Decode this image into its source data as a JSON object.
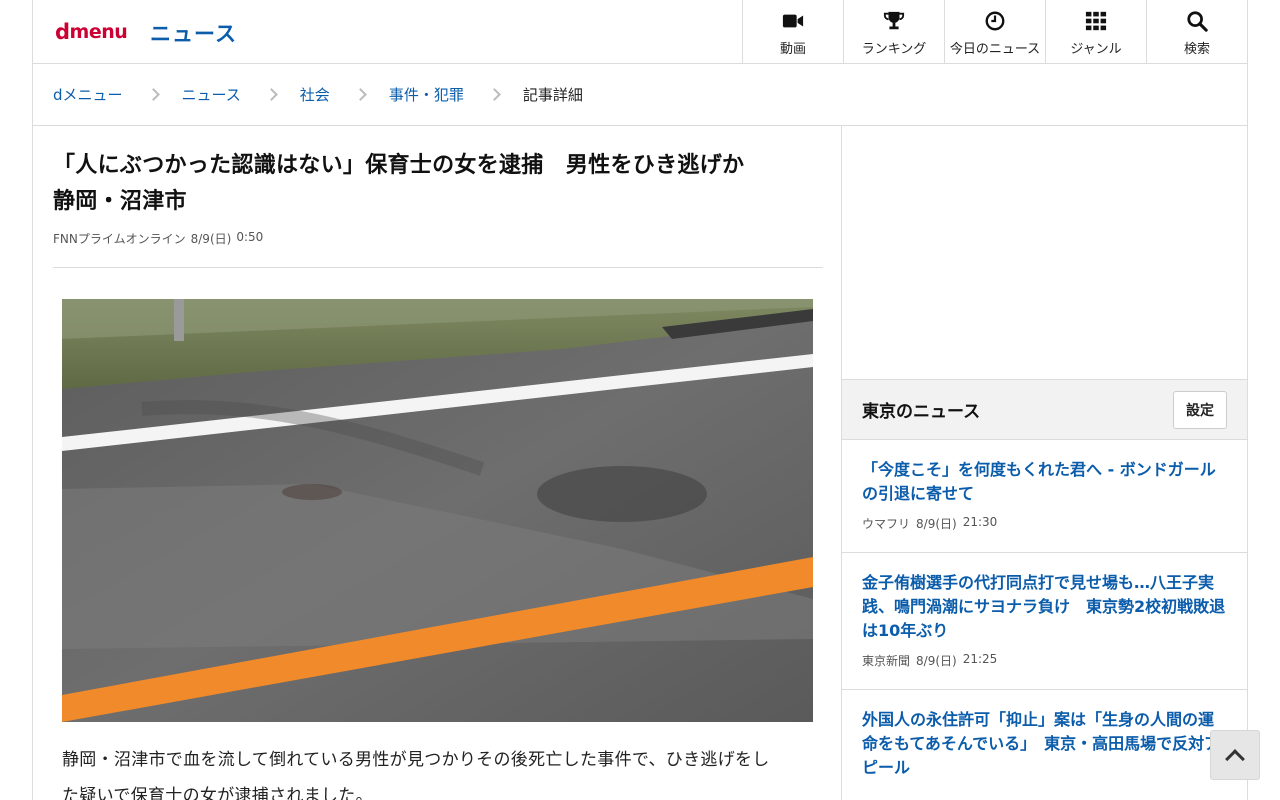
{
  "header": {
    "logo_d": "d",
    "logo_menu": "menu",
    "section": "ニュース",
    "nav": [
      {
        "label": "動画",
        "icon": "video-camera-icon"
      },
      {
        "label": "ランキング",
        "icon": "trophy-icon"
      },
      {
        "label": "今日のニュース",
        "icon": "clock-icon"
      },
      {
        "label": "ジャンル",
        "icon": "grid-icon"
      },
      {
        "label": "検索",
        "icon": "search-icon"
      }
    ]
  },
  "breadcrumb": [
    "dメニュー",
    "ニュース",
    "社会",
    "事件・犯罪",
    "記事詳細"
  ],
  "article": {
    "title_line1": "「人にぶつかった認識はない」保育士の女を逮捕　男性をひき逃げか",
    "title_line2": "静岡・沼津市",
    "source": "FNNプライムオンライン",
    "date": "8/9(日)",
    "time": "0:50",
    "body_line1": "静岡・沼津市で血を流して倒れている男性が見つかりその後死亡した事件で、ひき逃げをし",
    "body_line2": "た疑いで保育士の女が逮捕されました。"
  },
  "sidebar": {
    "local_title": "東京のニュース",
    "settings_label": "設定",
    "news": [
      {
        "title": "「今度こそ」を何度もくれた君へ - ボンドガールの引退に寄せて",
        "source": "ウマフリ",
        "date": "8/9(日)",
        "time": "21:30"
      },
      {
        "title": "金子侑樹選手の代打同点打で見せ場も…八王子実践、鳴門渦潮にサヨナラ負け　東京勢2校初戦敗退は10年ぶり",
        "source": "東京新聞",
        "date": "8/9(日)",
        "time": "21:25"
      },
      {
        "title": "外国人の永住許可「抑止」案は「生身の人間の運命をもてあそんでいる」　東京・高田馬場で反対アピール",
        "source": "",
        "date": "",
        "time": ""
      }
    ]
  },
  "colors": {
    "brand_red": "#cc0033",
    "link_blue": "#0b5cab"
  }
}
